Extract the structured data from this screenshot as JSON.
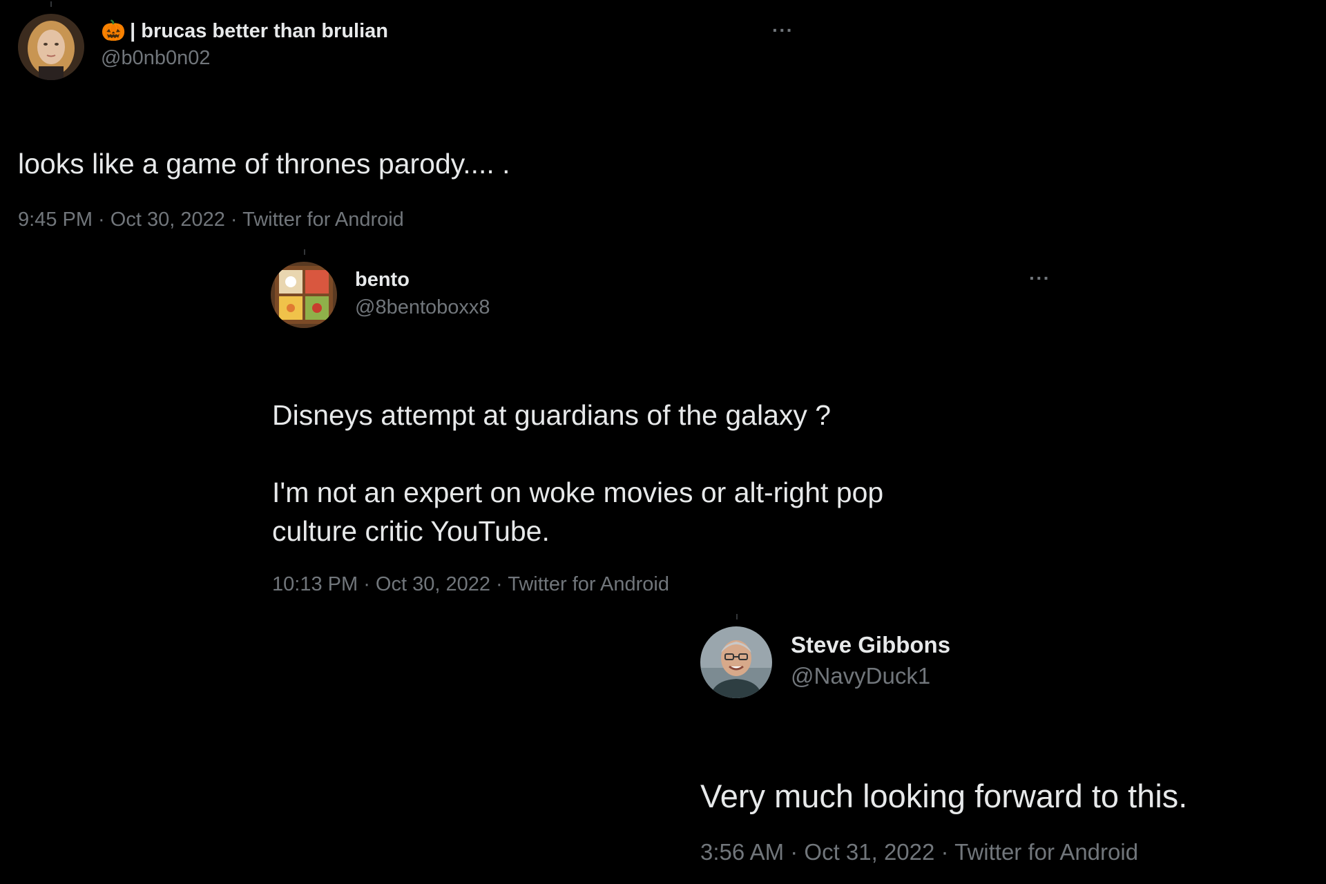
{
  "tweets": [
    {
      "display_name": "| brucas better than brulian",
      "name_emoji": "🎃",
      "handle": "@b0nb0n02",
      "more_label": "···",
      "text": "looks like a game of thrones parody.... .",
      "time": "9:45 PM",
      "date": "Oct 30, 2022",
      "source": "Twitter for Android",
      "separator": " · "
    },
    {
      "display_name": "bento",
      "handle": "@8bentoboxx8",
      "more_label": "···",
      "text": "Disneys attempt at guardians of the galaxy ?\n\n I'm not an expert on woke movies or alt-right pop\nculture critic YouTube.",
      "time": "10:13 PM",
      "date": "Oct 30, 2022",
      "source": "Twitter for Android",
      "separator": " · "
    },
    {
      "display_name": "Steve Gibbons",
      "handle": "@NavyDuck1",
      "text": "Very much looking forward to this.",
      "time": "3:56 AM",
      "date": "Oct 31, 2022",
      "source": "Twitter for Android",
      "separator": " · "
    }
  ],
  "colors": {
    "background": "#000000",
    "primary_text": "#e7e9ea",
    "secondary_text": "#71767b"
  }
}
